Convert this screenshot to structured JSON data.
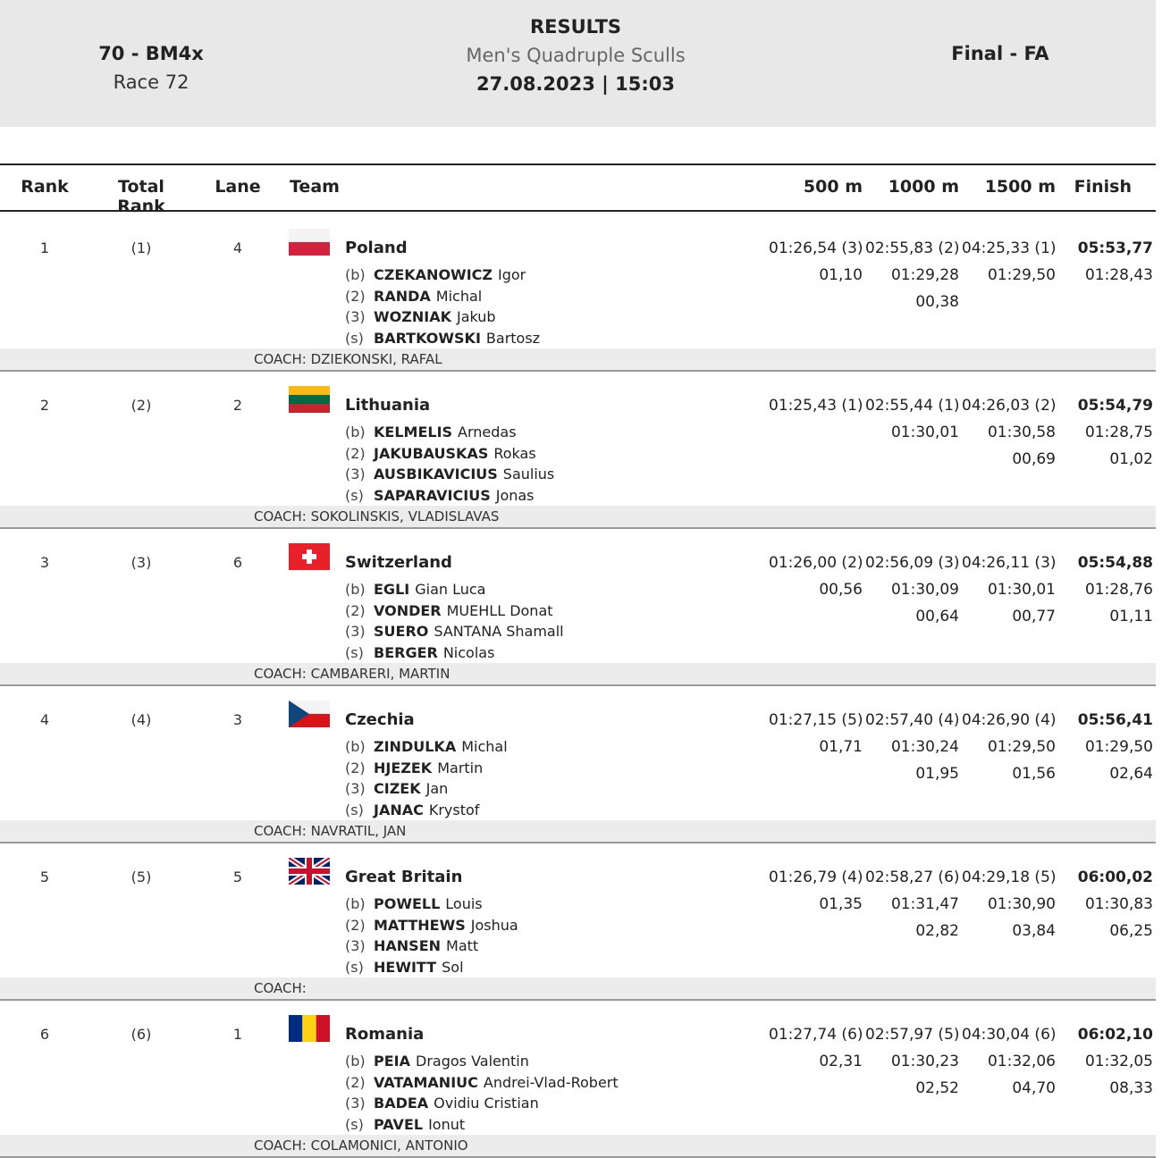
{
  "header": {
    "event_code": "70 - BM4x",
    "race": "Race 72",
    "results_title": "RESULTS",
    "event_name": "Men's Quadruple Sculls",
    "datetime": "27.08.2023 | 15:03",
    "phase": "Final - FA"
  },
  "columns": {
    "rank": "Rank",
    "total_rank": "Total Rank",
    "lane": "Lane",
    "team": "Team",
    "m500": "500 m",
    "m1000": "1000 m",
    "m1500": "1500 m",
    "finish": "Finish"
  },
  "rows": [
    {
      "rank": "1",
      "total_rank": "(1)",
      "lane": "4",
      "team": "Poland",
      "flag": "poland-flag",
      "crew": [
        {
          "seat": "(b)",
          "surname": "CZEKANOWICZ",
          "given": "Igor"
        },
        {
          "seat": "(2)",
          "surname": "RANDA",
          "given": "Michal"
        },
        {
          "seat": "(3)",
          "surname": "WOZNIAK",
          "given": "Jakub"
        },
        {
          "seat": "(s)",
          "surname": "BARTKOWSKI",
          "given": "Bartosz"
        }
      ],
      "m500": [
        "01:26,54 (3)",
        "01,10",
        ""
      ],
      "m1000": [
        "02:55,83 (2)",
        "01:29,28",
        "00,38"
      ],
      "m1500": [
        "04:25,33 (1)",
        "01:29,50",
        ""
      ],
      "finish": [
        "05:53,77",
        "01:28,43",
        ""
      ],
      "coach": "COACH: DZIEKONSKI, RAFAL"
    },
    {
      "rank": "2",
      "total_rank": "(2)",
      "lane": "2",
      "team": "Lithuania",
      "flag": "lithuania-flag",
      "crew": [
        {
          "seat": "(b)",
          "surname": "KELMELIS",
          "given": "Arnedas"
        },
        {
          "seat": "(2)",
          "surname": "JAKUBAUSKAS",
          "given": "Rokas"
        },
        {
          "seat": "(3)",
          "surname": "AUSBIKAVICIUS",
          "given": "Saulius"
        },
        {
          "seat": "(s)",
          "surname": "SAPARAVICIUS",
          "given": "Jonas"
        }
      ],
      "m500": [
        "01:25,43 (1)",
        "",
        ""
      ],
      "m1000": [
        "02:55,44 (1)",
        "01:30,01",
        ""
      ],
      "m1500": [
        "04:26,03 (2)",
        "01:30,58",
        "00,69"
      ],
      "finish": [
        "05:54,79",
        "01:28,75",
        "01,02"
      ],
      "coach": "COACH: SOKOLINSKIS, VLADISLAVAS"
    },
    {
      "rank": "3",
      "total_rank": "(3)",
      "lane": "6",
      "team": "Switzerland",
      "flag": "switzerland-flag",
      "crew": [
        {
          "seat": "(b)",
          "surname": "EGLI",
          "given": "Gian Luca"
        },
        {
          "seat": "(2)",
          "surname": "VONDER",
          "given": "MUEHLL Donat"
        },
        {
          "seat": "(3)",
          "surname": "SUERO",
          "given": "SANTANA Shamall"
        },
        {
          "seat": "(s)",
          "surname": "BERGER",
          "given": "Nicolas"
        }
      ],
      "m500": [
        "01:26,00 (2)",
        "00,56",
        ""
      ],
      "m1000": [
        "02:56,09 (3)",
        "01:30,09",
        "00,64"
      ],
      "m1500": [
        "04:26,11 (3)",
        "01:30,01",
        "00,77"
      ],
      "finish": [
        "05:54,88",
        "01:28,76",
        "01,11"
      ],
      "coach": "COACH: CAMBARERI, MARTIN"
    },
    {
      "rank": "4",
      "total_rank": "(4)",
      "lane": "3",
      "team": "Czechia",
      "flag": "czechia-flag",
      "crew": [
        {
          "seat": "(b)",
          "surname": "ZINDULKA",
          "given": "Michal"
        },
        {
          "seat": "(2)",
          "surname": "HJEZEK",
          "given": "Martin"
        },
        {
          "seat": "(3)",
          "surname": "CIZEK",
          "given": "Jan"
        },
        {
          "seat": "(s)",
          "surname": "JANAC",
          "given": "Krystof"
        }
      ],
      "m500": [
        "01:27,15 (5)",
        "01,71",
        ""
      ],
      "m1000": [
        "02:57,40 (4)",
        "01:30,24",
        "01,95"
      ],
      "m1500": [
        "04:26,90 (4)",
        "01:29,50",
        "01,56"
      ],
      "finish": [
        "05:56,41",
        "01:29,50",
        "02,64"
      ],
      "coach": "COACH: NAVRATIL, JAN"
    },
    {
      "rank": "5",
      "total_rank": "(5)",
      "lane": "5",
      "team": "Great Britain",
      "flag": "great-britain-flag",
      "crew": [
        {
          "seat": "(b)",
          "surname": "POWELL",
          "given": "Louis"
        },
        {
          "seat": "(2)",
          "surname": "MATTHEWS",
          "given": "Joshua"
        },
        {
          "seat": "(3)",
          "surname": "HANSEN",
          "given": "Matt"
        },
        {
          "seat": "(s)",
          "surname": "HEWITT",
          "given": "Sol"
        }
      ],
      "m500": [
        "01:26,79 (4)",
        "01,35",
        ""
      ],
      "m1000": [
        "02:58,27 (6)",
        "01:31,47",
        "02,82"
      ],
      "m1500": [
        "04:29,18 (5)",
        "01:30,90",
        "03,84"
      ],
      "finish": [
        "06:00,02",
        "01:30,83",
        "06,25"
      ],
      "coach": "COACH:"
    },
    {
      "rank": "6",
      "total_rank": "(6)",
      "lane": "1",
      "team": "Romania",
      "flag": "romania-flag",
      "crew": [
        {
          "seat": "(b)",
          "surname": "PEIA",
          "given": "Dragos Valentin"
        },
        {
          "seat": "(2)",
          "surname": "VATAMANIUC",
          "given": "Andrei-Vlad-Robert"
        },
        {
          "seat": "(3)",
          "surname": "BADEA",
          "given": "Ovidiu Cristian"
        },
        {
          "seat": "(s)",
          "surname": "PAVEL",
          "given": "Ionut"
        }
      ],
      "m500": [
        "01:27,74 (6)",
        "02,31",
        ""
      ],
      "m1000": [
        "02:57,97 (5)",
        "01:30,23",
        "02,52"
      ],
      "m1500": [
        "04:30,04 (6)",
        "01:32,06",
        "04,70"
      ],
      "finish": [
        "06:02,10",
        "01:32,05",
        "08,33"
      ],
      "coach": "COACH: COLAMONICI, ANTONIO"
    }
  ]
}
